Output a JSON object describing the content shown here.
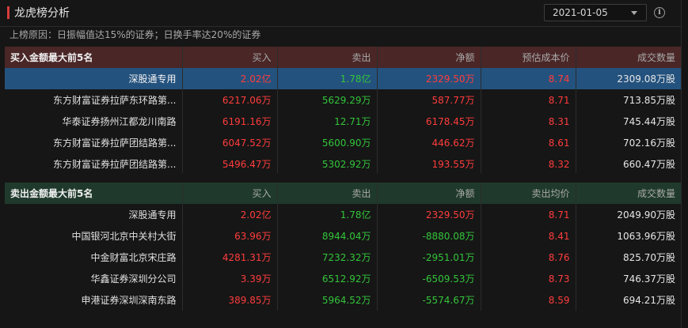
{
  "header": {
    "title": "龙虎榜分析",
    "date": "2021-01-05",
    "info_glyph": "i",
    "icons": {
      "date_dropdown": "chevron-down-icon",
      "info": "info-icon"
    }
  },
  "reason": "上榜原因：日振幅值达15%的证券；日换手率达20%的证券",
  "colors": {
    "rise": "#ff3c3c",
    "fall": "#33c43a",
    "highlight": "#24527e",
    "buy_header": "#4a2627",
    "sell_header": "#1f3a2c",
    "title_accent": "#d83c3c"
  },
  "buy_table": {
    "columns": [
      "买入金额最大前5名",
      "买入",
      "卖出",
      "净额",
      "预估成本价",
      "成交数量"
    ],
    "rows": [
      {
        "name": "深股通专用",
        "buy": "2.02亿",
        "sell": "1.78亿",
        "net": "2329.50万",
        "price": "8.74",
        "volume": "2309.08万股"
      },
      {
        "name": "东方财富证券拉萨东环路第...",
        "buy": "6217.06万",
        "sell": "5629.29万",
        "net": "587.77万",
        "price": "8.71",
        "volume": "713.85万股"
      },
      {
        "name": "华泰证券扬州江都龙川南路",
        "buy": "6191.16万",
        "sell": "12.71万",
        "net": "6178.45万",
        "price": "8.31",
        "volume": "745.44万股"
      },
      {
        "name": "东方财富证券拉萨团结路第...",
        "buy": "6047.52万",
        "sell": "5600.90万",
        "net": "446.62万",
        "price": "8.61",
        "volume": "702.16万股"
      },
      {
        "name": "东方财富证券拉萨团结路第...",
        "buy": "5496.47万",
        "sell": "5302.92万",
        "net": "193.55万",
        "price": "8.32",
        "volume": "660.47万股"
      }
    ]
  },
  "sell_table": {
    "columns": [
      "卖出金额最大前5名",
      "买入",
      "卖出",
      "净额",
      "卖出均价",
      "成交数量"
    ],
    "rows": [
      {
        "name": "深股通专用",
        "buy": "2.02亿",
        "sell": "1.78亿",
        "net": "2329.50万",
        "price": "8.71",
        "volume": "2049.90万股"
      },
      {
        "name": "中国银河北京中关村大街",
        "buy": "63.96万",
        "sell": "8944.04万",
        "net": "-8880.08万",
        "price": "8.41",
        "volume": "1063.96万股"
      },
      {
        "name": "中金财富北京宋庄路",
        "buy": "4281.31万",
        "sell": "7232.32万",
        "net": "-2951.01万",
        "price": "8.76",
        "volume": "825.70万股"
      },
      {
        "name": "华鑫证券深圳分公司",
        "buy": "3.39万",
        "sell": "6512.92万",
        "net": "-6509.53万",
        "price": "8.73",
        "volume": "746.37万股"
      },
      {
        "name": "申港证券深圳深南东路",
        "buy": "389.85万",
        "sell": "5964.52万",
        "net": "-5574.67万",
        "price": "8.59",
        "volume": "694.21万股"
      }
    ]
  }
}
